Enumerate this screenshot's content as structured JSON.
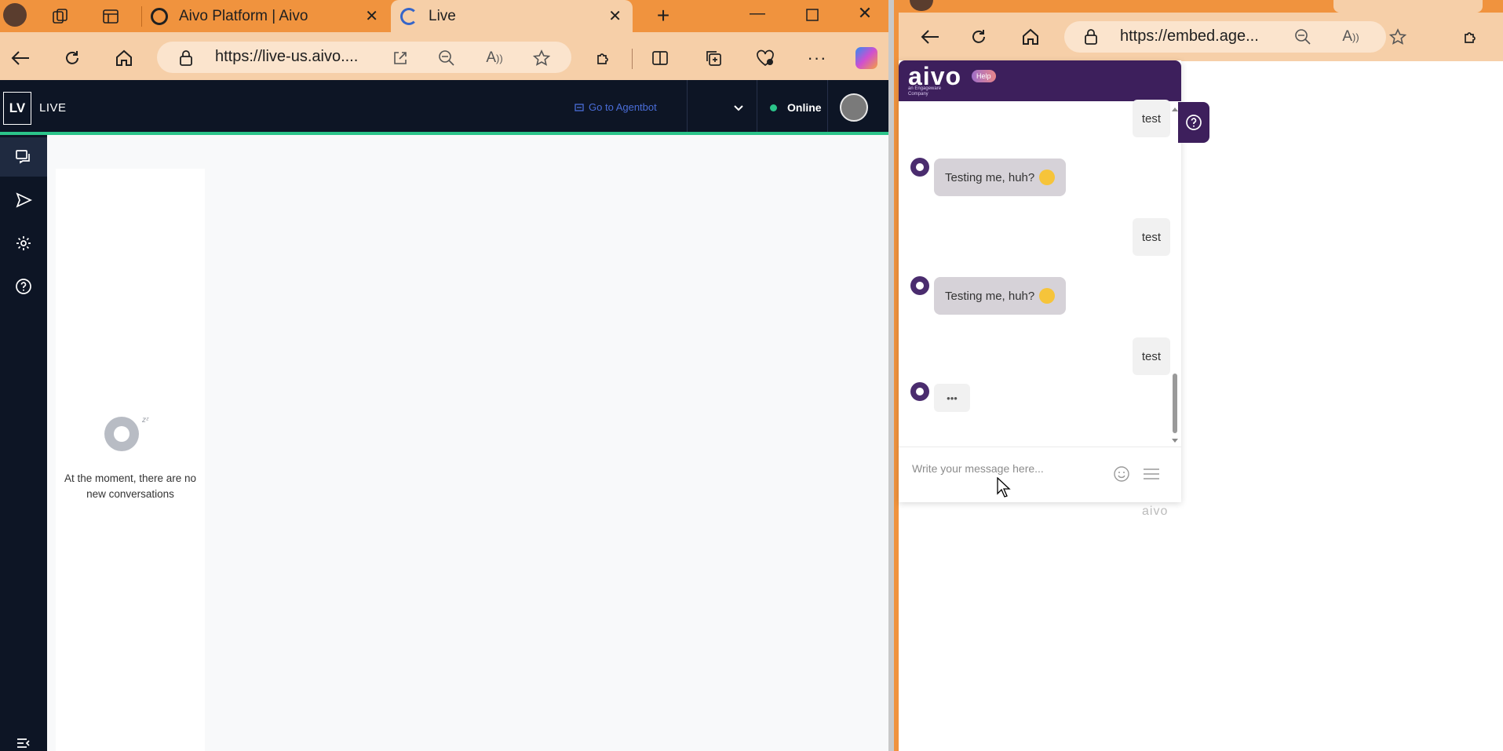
{
  "left_window": {
    "tabs": [
      {
        "label": "Aivo Platform | Aivo"
      },
      {
        "label": "Live"
      }
    ],
    "url": "https://live-us.aivo....",
    "header": {
      "logo": "LV",
      "brand": "LIVE",
      "goto_label": "Go to Agentbot",
      "status": "Online"
    },
    "empty_state": "At the moment, there are no new conversations"
  },
  "right_window": {
    "url": "https://embed.age...",
    "widget": {
      "logo_text": "aivo",
      "sub_brand": "an Engageware Company",
      "help_badge": "Help",
      "messages": [
        {
          "from": "user",
          "text": "test"
        },
        {
          "from": "bot",
          "text": "Testing me, huh?"
        },
        {
          "from": "user",
          "text": "test"
        },
        {
          "from": "bot",
          "text": "Testing me, huh?"
        },
        {
          "from": "user",
          "text": "test"
        },
        {
          "from": "bot",
          "text": "•••"
        }
      ],
      "input_placeholder": "Write your message here...",
      "footer_brand": "aivo"
    }
  },
  "colors": {
    "tabbar": "#f0933e",
    "toolbar": "#f6cfa8",
    "app_header": "#0d1525",
    "accent_green": "#2bc48a",
    "widget_purple": "#3d1f5c"
  }
}
